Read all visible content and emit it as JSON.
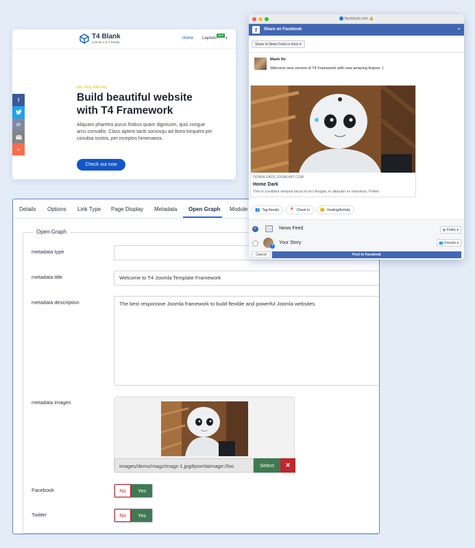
{
  "site": {
    "logo_title": "T4 Blank",
    "logo_sub": "Joomla 3 & 4 Ready",
    "nav_home": "Home",
    "nav_layouts": "Layouts",
    "nav_new_badge": "NEW",
    "eyebrow": "WE ARE MAKING",
    "hero_title": "Build beautiful website with T4 Framework",
    "hero_text": "Aliquam pharetra purus finibus quam dignissim, quis congue arcu convallis. Class aptent taciti sociosqu ad litora torquent per conubia nostra, per inceptos himenaeos.",
    "cta": "Check out now"
  },
  "admin": {
    "tabs": [
      "Details",
      "Options",
      "Link Type",
      "Page Display",
      "Metadata",
      "Open Graph",
      "Module A"
    ],
    "legend": "Open Graph",
    "labels": {
      "type": "metadata type",
      "title": "metadata title",
      "description": "metadata description",
      "images": "metadata images",
      "facebook": "Facebook",
      "twitter": "Twitter"
    },
    "values": {
      "type": "",
      "title": "Welcome to T4 Joomla Template Framework",
      "description": "The best responsive Joomla framework to build flexible and powerful Joomla websites.",
      "image_path": "images/demo/magz/magz-1.jpg#joomlaImage://loc"
    },
    "select_label": "Select",
    "remove_label": "✕",
    "toggle_no": "No",
    "toggle_yes": "Yes"
  },
  "fb": {
    "url": "facebook.com",
    "header": "Share on Facebook",
    "destination": "Share to News Feed or story",
    "user": "Manh Nv",
    "message": "Welcome new version of T4 Framework with new amazing feature :)",
    "link_domain": "DOWNLOADS.JOOMLART.COM",
    "link_title": "Home Dark",
    "link_desc": "This is curabitur tempus lacus id orci feugiat, in aliquam ex maximus. Pellen",
    "actions": [
      "Tag friends",
      "Check in",
      "Feeling/Activity"
    ],
    "news_feed": "News Feed",
    "your_story": "Your Story",
    "public": "Public",
    "friends": "Friends",
    "cancel": "Cancel",
    "post": "Post to Facebook"
  },
  "colors": {
    "accent_blue": "#1456c7",
    "facebook_blue": "#4267b2",
    "yes_green": "#3f7a52",
    "no_red": "#c0262d"
  }
}
